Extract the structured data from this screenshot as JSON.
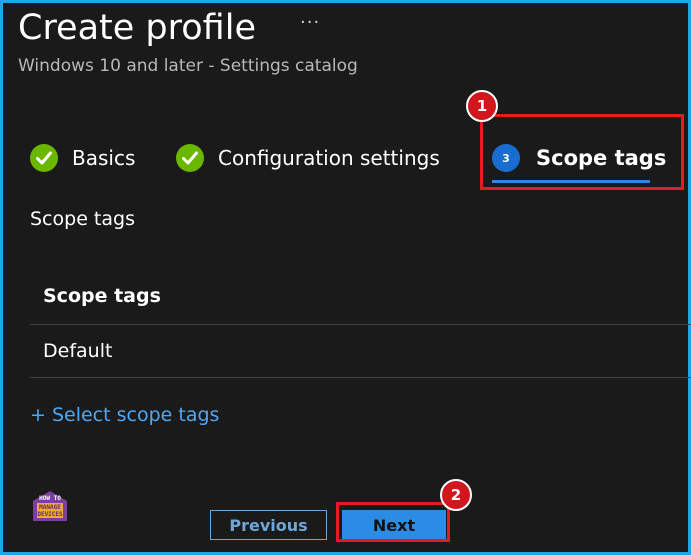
{
  "header": {
    "title": "Create profile",
    "more_label": "···",
    "subtitle": "Windows 10 and later - Settings catalog"
  },
  "steps": [
    {
      "label": "Basics",
      "state": "completed"
    },
    {
      "label": "Configuration settings",
      "state": "completed"
    },
    {
      "number": "3",
      "label": "Scope tags",
      "state": "current"
    }
  ],
  "section": {
    "label": "Scope tags"
  },
  "table": {
    "header": "Scope tags",
    "rows": [
      "Default"
    ]
  },
  "select_link": "+ Select scope tags",
  "footer": {
    "previous_label": "Previous",
    "next_label": "Next"
  },
  "annotations": {
    "callout_1": "1",
    "callout_2": "2"
  },
  "logo": {
    "line1": "HOW TO",
    "line2": "MANAGE",
    "line3": "DEVICES"
  },
  "colors": {
    "accent": "#2b8ce6",
    "check": "#6bb700",
    "highlight": "#e31b23",
    "frame": "#1ea7e8",
    "link": "#4ea8f5"
  }
}
